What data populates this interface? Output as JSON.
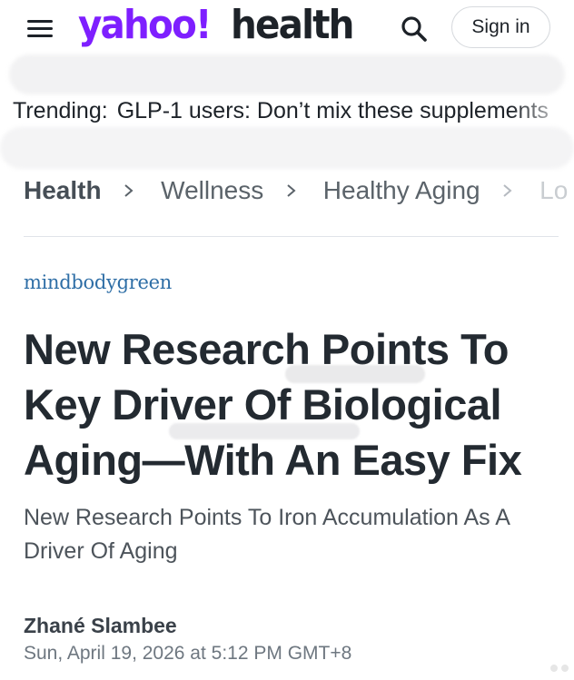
{
  "header": {
    "logo_brand": "yahoo!",
    "logo_section": "health",
    "signin_label": "Sign in",
    "brand_color": "#7e1fff"
  },
  "icons": {
    "menu": "hamburger-menu-icon",
    "search": "search-icon",
    "chevron": "chevron-right-icon"
  },
  "trending": {
    "label": "Trending:",
    "link": "GLP-1 users: Don’t mix these supplements"
  },
  "breadcrumb": {
    "items": [
      "Health",
      "Wellness",
      "Healthy Aging",
      "Lo"
    ]
  },
  "article": {
    "provider": "mindbodygreen",
    "title": "New Research Points To Key Driver Of Biological Aging—With An Easy Fix",
    "subtitle": "New Research Points To Iron Accumulation As A Driver Of Aging",
    "author": "Zhané Slambee",
    "date": "Sun, April 19, 2026 at 5:12 PM GMT+8"
  }
}
